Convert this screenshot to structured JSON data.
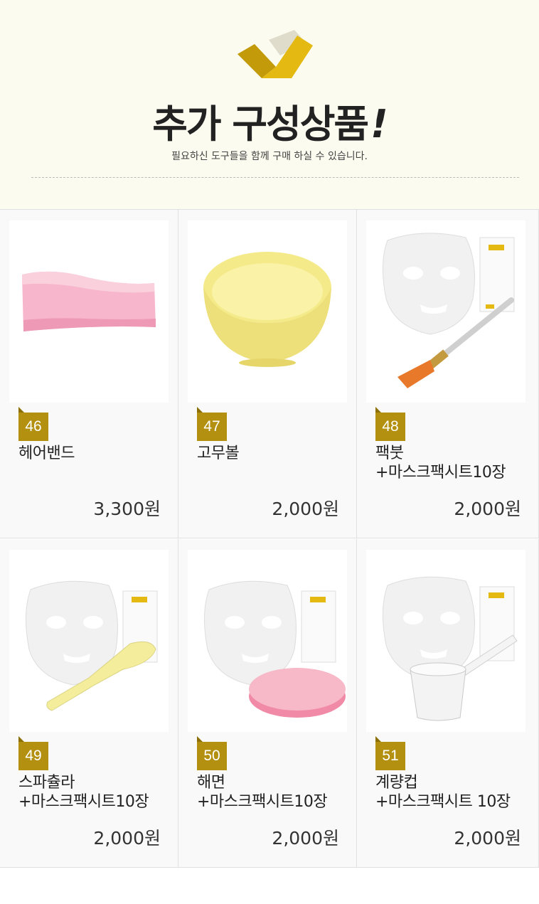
{
  "header": {
    "title": "추가 구성상품",
    "title_mark": "!",
    "subtitle": "필요하신 도구들을 함께 구매 하실 수 있습니다."
  },
  "colors": {
    "accent": "#b3900f",
    "header_bg": "#fcfbef",
    "logo_dark": "#c29a0a",
    "logo_light": "#e3b912"
  },
  "products": [
    {
      "number": "46",
      "name_line1": "헤어밴드",
      "name_line2": "",
      "price": "3,300원",
      "image": "pink-hair-band"
    },
    {
      "number": "47",
      "name_line1": "고무볼",
      "name_line2": "",
      "price": "2,000원",
      "image": "yellow-rubber-bowl"
    },
    {
      "number": "48",
      "name_line1": "팩붓",
      "name_line2": "+마스크팩시트10장",
      "price": "2,000원",
      "image": "mask-sheet-with-brush"
    },
    {
      "number": "49",
      "name_line1": "스파츌라",
      "name_line2": "+마스크팩시트10장",
      "price": "2,000원",
      "image": "mask-sheet-with-spatula"
    },
    {
      "number": "50",
      "name_line1": "해면",
      "name_line2": "+마스크팩시트10장",
      "price": "2,000원",
      "image": "mask-sheet-with-sponge"
    },
    {
      "number": "51",
      "name_line1": "계량컵",
      "name_line2": "+마스크팩시트 10장",
      "price": "2,000원",
      "image": "mask-sheet-with-measuring-cup"
    }
  ]
}
